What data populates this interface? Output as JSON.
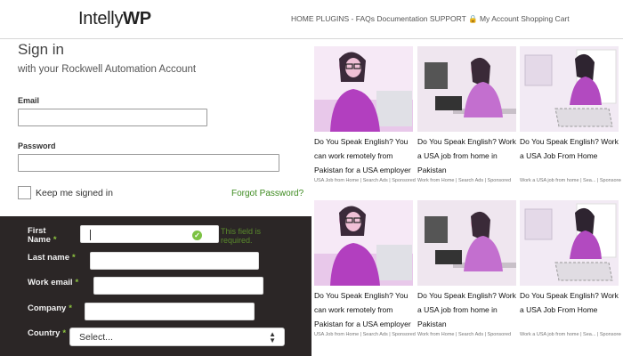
{
  "header": {
    "logo_text": "Intelly",
    "logo_bold": "WP",
    "nav": "HOME PLUGINS - FAQs Documentation SUPPORT 🔒 My Account Shopping Cart"
  },
  "signin": {
    "title": "Sign in",
    "subtitle": "with your Rockwell Automation Account",
    "email_label": "Email",
    "email_value": "",
    "password_label": "Password",
    "password_value": "",
    "keep_signed_in": "Keep me signed in",
    "forgot": "Forgot Password?"
  },
  "form": {
    "first_name_label": "First Name",
    "last_name_label": "Last name",
    "work_email_label": "Work email",
    "company_label": "Company",
    "country_label": "Country",
    "required_mark": "*",
    "error_text": "This field is required.",
    "country_selected": "Select...",
    "first_name_value": "",
    "last_name_value": "",
    "work_email_value": "",
    "company_value": ""
  },
  "ads": [
    {
      "title": "Do You Speak English? You can work remotely from Pakistan for a USA employer",
      "source": "USA Job from Home",
      "sponsor": "Search Ads",
      "label": "Sponsored"
    },
    {
      "title": "Do You Speak English? Work a USA job from home in Pakistan",
      "source": "Work from Home",
      "sponsor": "Search Ads",
      "label": "Sponsored"
    },
    {
      "title": "Do You Speak English? Work a USA Job From Home",
      "source": "Work a USA job from home",
      "sponsor": "Sea...",
      "label": "Sponsored"
    },
    {
      "title": "Do You Speak English? You can work remotely from Pakistan for a USA employer",
      "source": "USA Job from Home",
      "sponsor": "Search Ads",
      "label": "Sponsored"
    },
    {
      "title": "Do You Speak English? Work a USA job from home in Pakistan",
      "source": "Work from Home",
      "sponsor": "Search Ads",
      "label": "Sponsored"
    },
    {
      "title": "Do You Speak English? Work a USA Job From Home",
      "source": "Work a USA job from home",
      "sponsor": "Sea...",
      "label": "Sponsored"
    }
  ],
  "colors": {
    "accent_green": "#3c8a1e",
    "dark_panel": "#2b2626",
    "required_green": "#8ec63f",
    "ad_tint": "#c060d0"
  },
  "icons": {
    "error_badge": "green-check-icon",
    "select_arrows": "sort-arrows-icon",
    "nav_lock": "lock-icon"
  }
}
